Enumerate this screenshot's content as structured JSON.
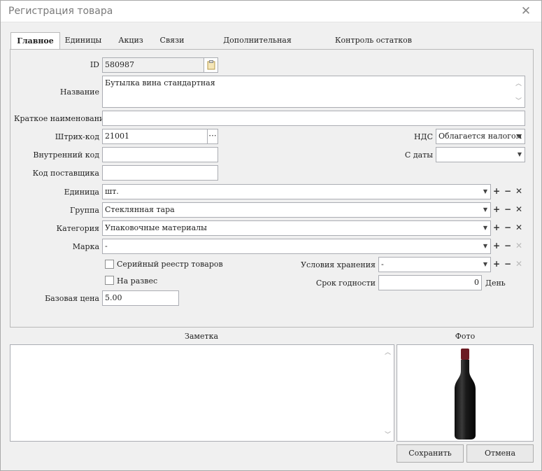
{
  "window": {
    "title": "Регистрация товара"
  },
  "tabs": [
    {
      "label": "Главное"
    },
    {
      "label": "Единицы"
    },
    {
      "label": "Акциз"
    },
    {
      "label": "Связи"
    },
    {
      "label": "Дополнительная информация"
    },
    {
      "label": "Контроль остатков"
    }
  ],
  "form": {
    "id_label": "ID",
    "id_value": "580987",
    "name_label": "Название",
    "name_value": "Бутылка вина стандартная",
    "short_name_label": "Краткое наименование",
    "short_name_value": "",
    "barcode_label": "Штрих-код",
    "barcode_value": "21001",
    "barcode_more": "···",
    "vat_label": "НДС",
    "vat_value": "Облагается налогом",
    "internal_code_label": "Внутренний код",
    "internal_code_value": "",
    "from_date_label": "С даты",
    "from_date_value": "",
    "supplier_code_label": "Код поставщика",
    "supplier_code_value": "",
    "unit_label": "Единица",
    "unit_value": "шт.",
    "group_label": "Группа",
    "group_value": "Стеклянная тара",
    "category_label": "Категория",
    "category_value": "Упаковочные материалы",
    "brand_label": "Марка",
    "brand_value": "-",
    "serial_registry_label": "Серийный реестр товаров",
    "serial_registry_checked": false,
    "bulk_label": "На развес",
    "bulk_checked": false,
    "storage_label": "Условия хранения",
    "storage_value": "-",
    "shelf_life_label": "Срок годности",
    "shelf_life_value": "0",
    "shelf_life_unit": "День",
    "base_price_label": "Базовая цена",
    "base_price_value": "5.00"
  },
  "note": {
    "label": "Заметка",
    "value": ""
  },
  "photo": {
    "label": "Фото"
  },
  "buttons": {
    "save": "Сохранить",
    "cancel": "Отмена"
  },
  "icons": {
    "close": "close-icon",
    "clipboard": "clipboard-icon",
    "dropdown": "chevron-down-icon",
    "add": "plus-icon",
    "remove": "minus-icon",
    "clear": "x-icon"
  }
}
